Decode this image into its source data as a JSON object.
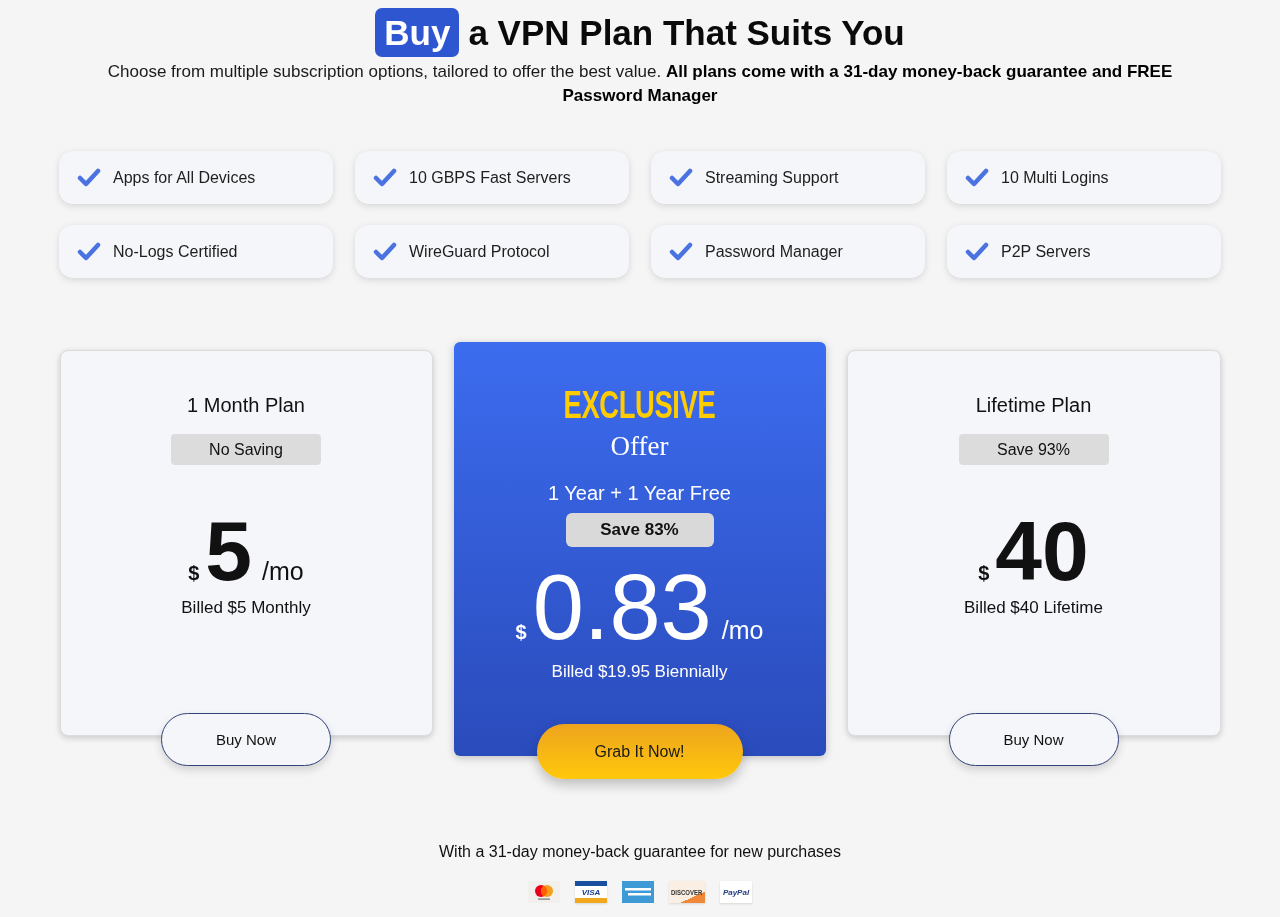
{
  "header": {
    "title": [
      {
        "text": "Buy",
        "highlighted": true
      },
      {
        "text": "a VPN Plan That Suits You",
        "highlighted": false
      }
    ],
    "subtitle": "Choose from multiple subscription options, tailored to offer the best value. **All plans come with a 31-day money-back guarantee and FREE Password Manager**"
  },
  "features": [
    {
      "label": "Apps for All Devices"
    },
    {
      "label": "10 GBPS Fast Servers"
    },
    {
      "label": "Streaming Support"
    },
    {
      "label": "10 Multi Logins"
    },
    {
      "label": "No-Logs Certified"
    },
    {
      "label": "WireGuard Protocol"
    },
    {
      "label": "Password Manager"
    },
    {
      "label": "P2P Servers"
    }
  ],
  "plans": [
    {
      "kind": "standard",
      "name": "1 Month Plan",
      "badge": "No Saving",
      "currency": "$",
      "price": "5",
      "period": "/mo",
      "billing": "Billed $5 Monthly",
      "button": "Buy Now"
    },
    {
      "kind": "featured",
      "eyebrow": "EXCLUSIVE",
      "eyebrow_sub": "Offer",
      "name": "1 Year + 1 Year Free",
      "badge": "Save 83%",
      "currency": "$",
      "price": "0.83",
      "period": "/mo",
      "billing": "Billed $19.95 Biennially",
      "button": "Grab It Now!"
    },
    {
      "kind": "standard",
      "name": "Lifetime Plan",
      "badge": "Save 93%",
      "currency": "$",
      "price": "40",
      "billing": "Billed $40 Lifetime",
      "button": "Buy Now"
    }
  ],
  "footer": {
    "guarantee": "With a 31-day money-back guarantee for new purchases",
    "payment_methods": [
      {
        "kind": "mastercard"
      },
      {
        "kind": "visa",
        "label": "VISA"
      },
      {
        "kind": "amex"
      },
      {
        "kind": "discover",
        "label": "DISCOVER"
      },
      {
        "kind": "paypal",
        "label": "PayPal"
      }
    ]
  }
}
